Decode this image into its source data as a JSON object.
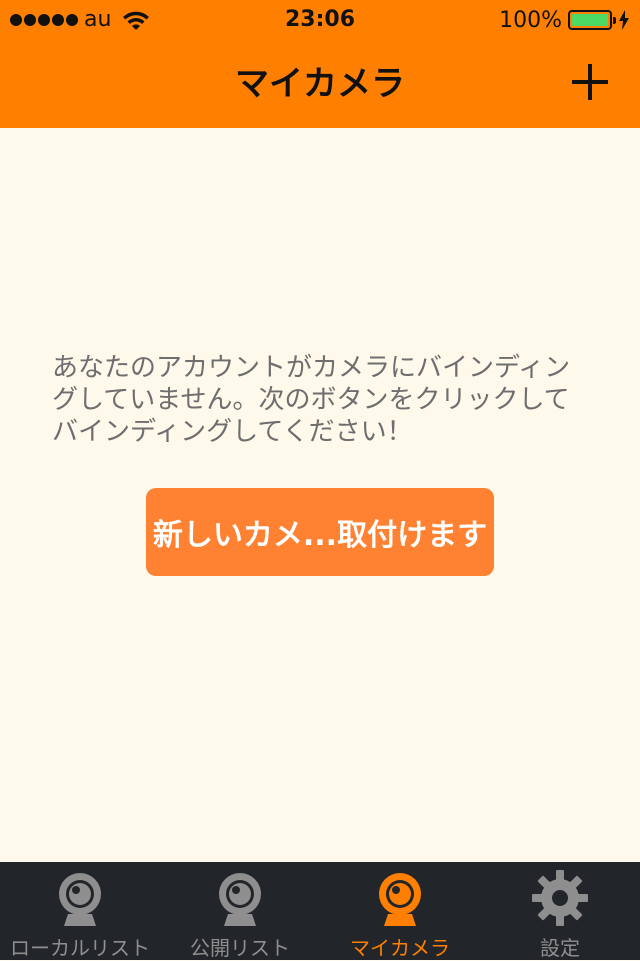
{
  "status_bar": {
    "carrier": "au",
    "time": "23:06",
    "battery": "100%"
  },
  "nav": {
    "title": "マイカメラ"
  },
  "message": "あなたのアカウントがカメラにバインディングしていません。次のボタンをクリックしてバインディングしてください！",
  "bind_button": "新しいカメ...取付けます",
  "tabs": [
    {
      "label": "ローカルリスト",
      "icon": "webcam-icon",
      "active": false
    },
    {
      "label": "公開リスト",
      "icon": "webcam-icon",
      "active": false
    },
    {
      "label": "マイカメラ",
      "icon": "webcam-icon",
      "active": true
    },
    {
      "label": "設定",
      "icon": "gear-icon",
      "active": false
    }
  ],
  "colors": {
    "accent": "#FF8000",
    "button": "#FF8132",
    "background": "#FFF9EC",
    "tab_bar": "#22262A",
    "battery": "#4CD964"
  }
}
